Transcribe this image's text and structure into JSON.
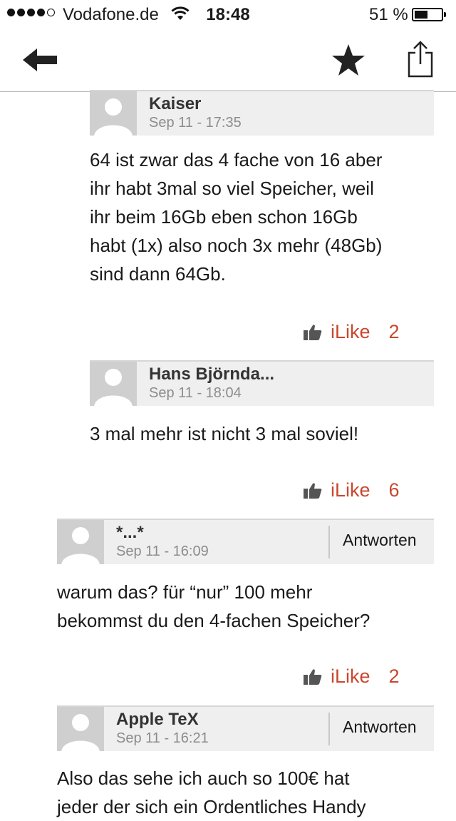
{
  "status_bar": {
    "carrier": "Vodafone.de",
    "time": "18:48",
    "battery": "51 %",
    "battery_level": 0.51
  },
  "nav": {
    "icons": [
      "back-arrow-icon",
      "star-icon",
      "share-icon"
    ]
  },
  "comments": [
    {
      "author": "Kaiser",
      "date": "Sep 11 - 17:35",
      "body": "64 ist zwar das 4 fache von 16 aber\nihr habt 3mal so viel Speicher, weil\nihr beim 16Gb eben schon 16Gb\nhabt (1x) also noch 3x mehr (48Gb)\nsind dann 64Gb.",
      "like_label": "iLike",
      "likes": "2"
    },
    {
      "author": "Hans Björnda...",
      "date": "Sep 11 - 18:04",
      "body": "3 mal mehr ist nicht 3 mal soviel!",
      "like_label": "iLike",
      "likes": "6"
    },
    {
      "author": "*...*",
      "date": "Sep 11 - 16:09",
      "reply": "Antworten",
      "body": "warum das? für “nur” 100 mehr\nbekommst du den 4-fachen Speicher?",
      "like_label": "iLike",
      "likes": "2"
    },
    {
      "author": "Apple TeX",
      "date": "Sep 11 - 16:21",
      "reply": "Antworten",
      "body": "Also das sehe ich auch so 100€ hat\njeder der sich ein Ordentliches Handy"
    }
  ]
}
